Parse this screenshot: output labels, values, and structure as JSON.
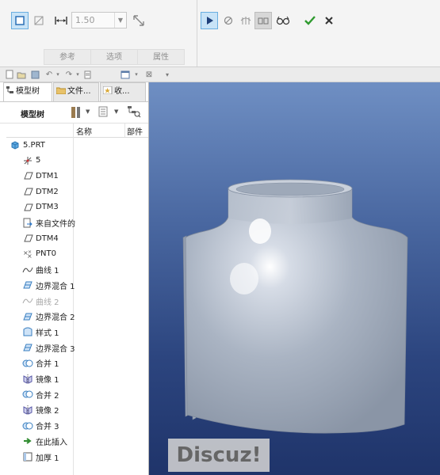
{
  "ribbon": {
    "thickness_value": "1.50",
    "tabs": [
      "参考",
      "选项",
      "属性"
    ],
    "icons": [
      "solid-surface-icon",
      "surface-icon",
      "thickness-icon",
      "flip-direction-icon",
      "pause-icon",
      "stop-icon",
      "preview-off-icon",
      "preview-glasses-icon",
      "verify-preview-icon",
      "ok-check-icon",
      "cancel-x-icon"
    ]
  },
  "quick_access": {
    "icons": [
      "new-icon",
      "open-icon",
      "save-icon",
      "undo-icon",
      "redo-icon",
      "regenerate-icon",
      "windows-icon",
      "close-window-icon",
      "customize-icon"
    ]
  },
  "left_panel": {
    "tabs": [
      "模型树",
      "文件...",
      "收..."
    ],
    "toolbar_label": "模型树",
    "columns": [
      "名称",
      "部件"
    ],
    "tree_items": [
      {
        "label": "5.PRT",
        "icon": "part-icon",
        "dim": false
      },
      {
        "label": "5",
        "icon": "coordinate-system-icon",
        "dim": false
      },
      {
        "label": "DTM1",
        "icon": "datum-plane-icon",
        "dim": false
      },
      {
        "label": "DTM2",
        "icon": "datum-plane-icon",
        "dim": false
      },
      {
        "label": "DTM3",
        "icon": "datum-plane-icon",
        "dim": false
      },
      {
        "label": "来自文件的",
        "icon": "file-import-icon",
        "dim": false
      },
      {
        "label": "DTM4",
        "icon": "datum-plane-icon",
        "dim": false
      },
      {
        "label": "PNT0",
        "icon": "datum-point-icon",
        "dim": false
      },
      {
        "label": "曲线 1",
        "icon": "curve-icon",
        "dim": false
      },
      {
        "label": "边界混合 1",
        "icon": "boundary-blend-icon",
        "dim": false
      },
      {
        "label": "曲线 2",
        "icon": "curve-icon",
        "dim": true
      },
      {
        "label": "边界混合 2",
        "icon": "boundary-blend-icon",
        "dim": false
      },
      {
        "label": "样式 1",
        "icon": "style-icon",
        "dim": false
      },
      {
        "label": "边界混合 3",
        "icon": "boundary-blend-icon",
        "dim": false
      },
      {
        "label": "合并 1",
        "icon": "merge-icon",
        "dim": false
      },
      {
        "label": "镜像 1",
        "icon": "mirror-icon",
        "dim": false
      },
      {
        "label": "合并 2",
        "icon": "merge-icon",
        "dim": false
      },
      {
        "label": "镜像 2",
        "icon": "mirror-icon",
        "dim": false
      },
      {
        "label": "合并 3",
        "icon": "merge-icon",
        "dim": false
      },
      {
        "label": "在此插入",
        "icon": "insert-here-arrow-icon",
        "dim": false
      },
      {
        "label": "加厚 1",
        "icon": "thicken-icon",
        "dim": false
      }
    ]
  },
  "viewport": {
    "watermark": "Discuz!"
  },
  "colors": {
    "accent": "#1e7fd0",
    "ok_green": "#2e9a2e",
    "viewport_top": "#6f8fc3",
    "viewport_bottom": "#1f346a",
    "model_surface": "#a9b4c4"
  }
}
